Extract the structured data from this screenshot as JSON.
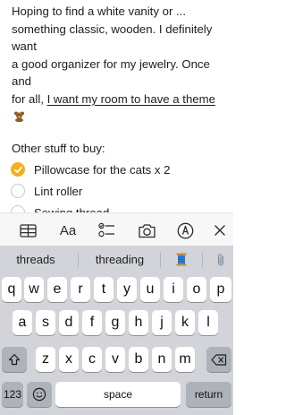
{
  "note": {
    "para_line1": "Hoping to find a white vanity or ...",
    "para_line2": "something classic, wooden. I definitely want",
    "para_line3": "a good organizer for my jewelry. Once and",
    "para_line4_prefix": "for all, ",
    "para_line4_link": "I want my room to have a theme",
    "subheading": "Other stuff to buy:",
    "checklist": [
      {
        "label": "Pillowcase for the cats x 2",
        "checked": true
      },
      {
        "label": "Lint roller",
        "checked": false
      },
      {
        "label": "Sewing thread",
        "checked": false
      }
    ],
    "accent_color": "#f2b01e"
  },
  "toolbar": {
    "icons": [
      "table-icon",
      "format-text-icon",
      "checklist-icon",
      "camera-icon",
      "markup-icon",
      "close-icon"
    ],
    "format_label": "Aa"
  },
  "keyboard": {
    "suggestions": [
      "threads",
      "threading"
    ],
    "suggestion_icons": [
      "thread-spool-emoji",
      "paperclip-icon"
    ],
    "row1": [
      "q",
      "w",
      "e",
      "r",
      "t",
      "y",
      "u",
      "i",
      "o",
      "p"
    ],
    "row2": [
      "a",
      "s",
      "d",
      "f",
      "g",
      "h",
      "j",
      "k",
      "l"
    ],
    "row3": [
      "z",
      "x",
      "c",
      "v",
      "b",
      "n",
      "m"
    ],
    "numbers_label": "123",
    "space_label": "space",
    "return_label": "return"
  }
}
